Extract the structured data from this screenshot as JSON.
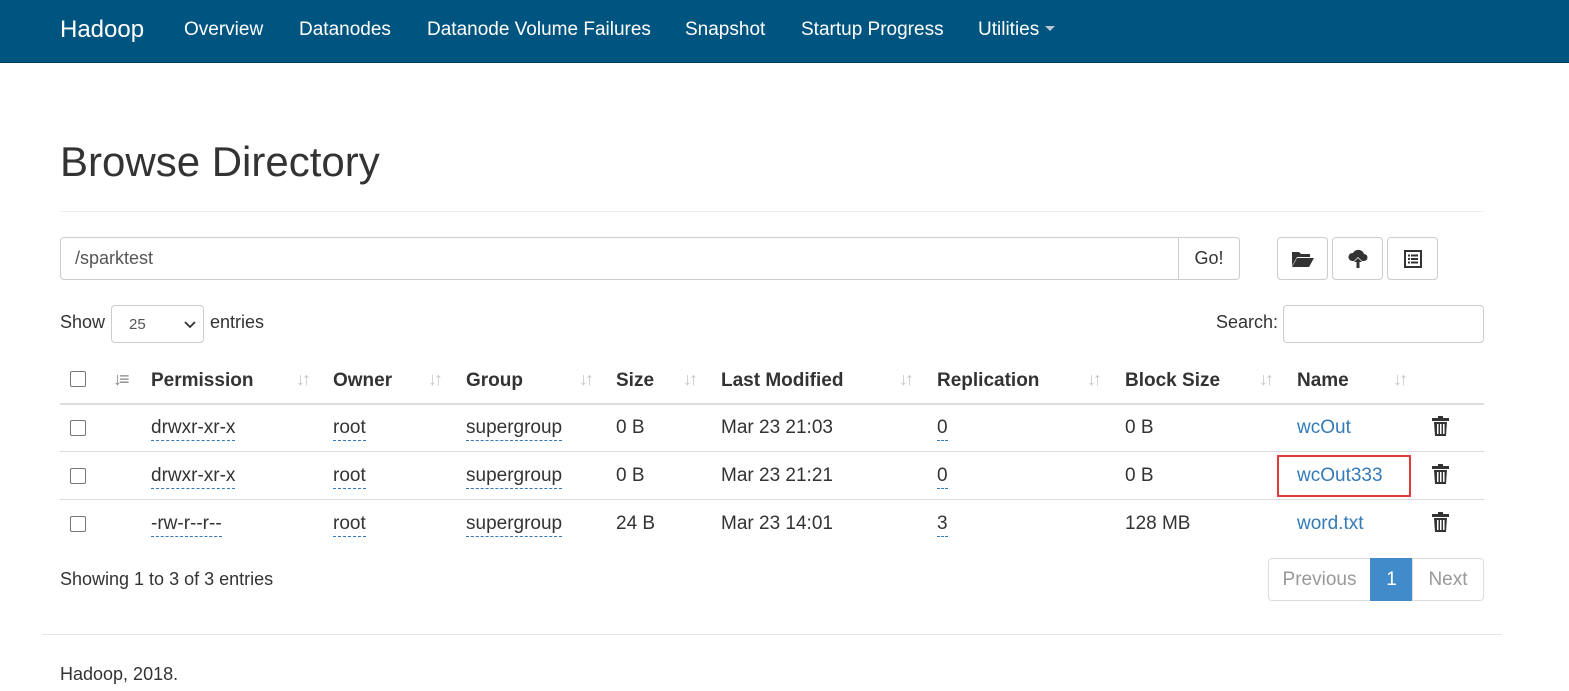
{
  "navbar": {
    "brand": "Hadoop",
    "items": [
      "Overview",
      "Datanodes",
      "Datanode Volume Failures",
      "Snapshot",
      "Startup Progress",
      "Utilities"
    ]
  },
  "page_title": "Browse Directory",
  "path": {
    "value": "/sparktest",
    "go_label": "Go!"
  },
  "toolbar_icons": [
    "folder-open-icon",
    "cloud-upload-icon",
    "list-alt-icon"
  ],
  "length": {
    "show_label": "Show",
    "selected": "25",
    "entries_label": "entries"
  },
  "search": {
    "label": "Search:",
    "value": ""
  },
  "table": {
    "headers": [
      "Permission",
      "Owner",
      "Group",
      "Size",
      "Last Modified",
      "Replication",
      "Block Size",
      "Name"
    ],
    "rows": [
      {
        "permission": "drwxr-xr-x",
        "owner": "root",
        "group": "supergroup",
        "size": "0 B",
        "modified": "Mar 23 21:03",
        "replication": "0",
        "block_size": "0 B",
        "name": "wcOut"
      },
      {
        "permission": "drwxr-xr-x",
        "owner": "root",
        "group": "supergroup",
        "size": "0 B",
        "modified": "Mar 23 21:21",
        "replication": "0",
        "block_size": "0 B",
        "name": "wcOut333"
      },
      {
        "permission": "-rw-r--r--",
        "owner": "root",
        "group": "supergroup",
        "size": "24 B",
        "modified": "Mar 23 14:01",
        "replication": "3",
        "block_size": "128 MB",
        "name": "word.txt"
      }
    ]
  },
  "info": "Showing 1 to 3 of 3 entries",
  "pagination": {
    "previous": "Previous",
    "current": "1",
    "next": "Next"
  },
  "footer": "Hadoop, 2018.",
  "colors": {
    "navbar": "#005580",
    "link": "#337ab7",
    "active_page": "#428bca",
    "highlight": "#e03a3a"
  }
}
